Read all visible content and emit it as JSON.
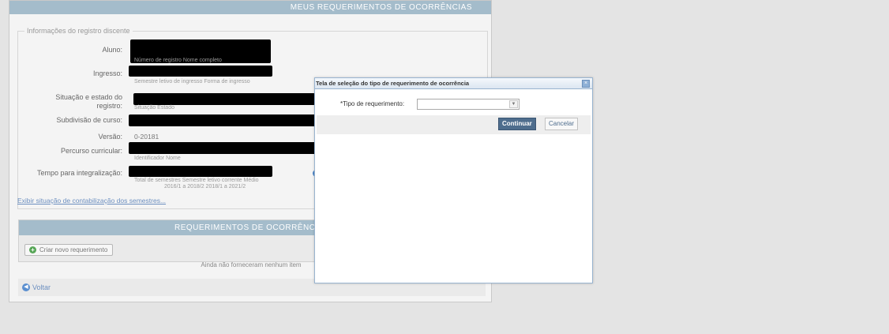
{
  "page": {
    "top_title": "MEUS REQUERIMENTOS DE OCORRÊNCIAS"
  },
  "registro": {
    "legend": "Informações do registro discente",
    "aluno": {
      "label": "Aluno:",
      "sub": "Número de registro   Nome completo"
    },
    "ingresso": {
      "label": "Ingresso:",
      "sub": "Semestre letivo de ingresso   Forma de ingresso"
    },
    "situacao": {
      "label_line1": "Situação e estado do",
      "label_line2": "registro:",
      "sub": "Situação       Estado"
    },
    "subdivisao": {
      "label": "Subdivisão de curso:"
    },
    "versao": {
      "label": "Versão:",
      "value": "0-20181"
    },
    "percurso": {
      "label": "Percurso curricular:",
      "sub": "Identificador            Nome"
    },
    "tempo": {
      "label": "Tempo para integralização:",
      "sub_line1": "Total de semestres   Semestre letivo corrente   Médio",
      "sub_line2": "2016/1 a 2018/2          2018/1 a 2021/2"
    },
    "exibir_link": "Exibir situação de contabilização dos semestres..."
  },
  "requerimentos": {
    "header": "REQUERIMENTOS DE OCORRÊNCIAS",
    "criar_button": "Criar novo requerimento",
    "empty_message": "Ainda não forneceram nenhum item"
  },
  "voltar": {
    "label": "Voltar"
  },
  "dialog": {
    "title": "Tela de seleção do tipo de requerimento de ocorrência",
    "field_label": "*Tipo de requerimento:",
    "select_value": "",
    "continuar_label": "Continuar",
    "cancelar_label": "Cancelar"
  },
  "icons": {
    "close": "close-icon",
    "plus": "plus-icon",
    "back": "back-arrow-icon",
    "info": "info-icon",
    "dropdown": "chevron-down-icon"
  },
  "colors": {
    "header_bar": "#a4bccb",
    "primary_button": "#4e6d8d",
    "link": "#6c8fc0"
  }
}
